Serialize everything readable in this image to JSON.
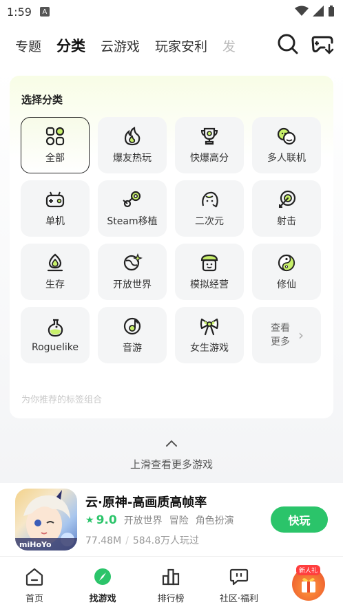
{
  "status_bar": {
    "time": "1:59",
    "notif_letter": "A"
  },
  "top_nav": {
    "tabs": [
      {
        "label": "专题"
      },
      {
        "label": "分类"
      },
      {
        "label": "云游戏"
      },
      {
        "label": "玩家安利"
      },
      {
        "label": "发"
      }
    ],
    "active_tab": "分类"
  },
  "category_panel": {
    "title": "选择分类",
    "categories": [
      {
        "label": "全部",
        "icon": "grid-icon"
      },
      {
        "label": "爆友热玩",
        "icon": "flame-icon"
      },
      {
        "label": "快爆高分",
        "icon": "trophy-icon"
      },
      {
        "label": "多人联机",
        "icon": "people-icon"
      },
      {
        "label": "单机",
        "icon": "gamepad-icon"
      },
      {
        "label": "Steam移植",
        "icon": "steam-icon"
      },
      {
        "label": "二次元",
        "icon": "anime-icon"
      },
      {
        "label": "射击",
        "icon": "target-icon"
      },
      {
        "label": "生存",
        "icon": "campfire-icon"
      },
      {
        "label": "开放世界",
        "icon": "planet-icon"
      },
      {
        "label": "模拟经营",
        "icon": "shop-icon"
      },
      {
        "label": "修仙",
        "icon": "yinyang-icon"
      },
      {
        "label": "Roguelike",
        "icon": "potion-icon"
      },
      {
        "label": "音游",
        "icon": "music-icon"
      },
      {
        "label": "女生游戏",
        "icon": "bow-icon"
      }
    ],
    "more_label": "查看更多",
    "recommend_label": "为你推荐的标签组合"
  },
  "scroll_hint": "上滑查看更多游戏",
  "game_card": {
    "title": "云·原神-高画质高帧率",
    "score": "9.0",
    "tags": [
      "开放世界",
      "冒险",
      "角色扮演"
    ],
    "size": "77.48M",
    "players": "584.8万人玩过",
    "play_label": "快玩",
    "icon_brand": "miHoYo"
  },
  "bottom_nav": {
    "items": [
      {
        "label": "首页"
      },
      {
        "label": "找游戏"
      },
      {
        "label": "排行榜"
      },
      {
        "label": "社区·福利"
      }
    ],
    "gift_badge": "新人礼"
  },
  "colors": {
    "accent_green": "#2bc46a",
    "highlight_lime": "#c8f06a"
  }
}
